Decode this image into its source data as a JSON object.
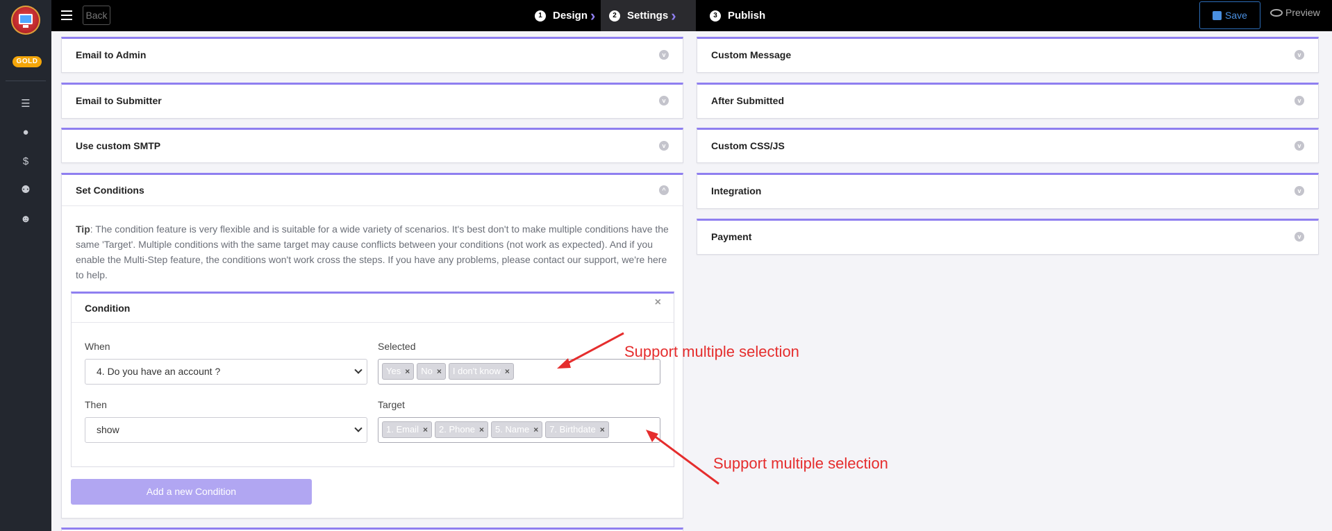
{
  "sidebar": {
    "badge": "GOLD",
    "items": [
      {
        "icon": "list-icon"
      },
      {
        "icon": "user-icon"
      },
      {
        "icon": "dollar-icon"
      },
      {
        "icon": "users-icon"
      },
      {
        "icon": "face-icon"
      }
    ]
  },
  "topbar": {
    "back_label": "Back",
    "steps": [
      {
        "num": "1",
        "label": "Design"
      },
      {
        "num": "2",
        "label": "Settings"
      },
      {
        "num": "3",
        "label": "Publish"
      }
    ],
    "save_label": "Save",
    "preview_label": "Preview"
  },
  "left_panels": {
    "email_admin": "Email to Admin",
    "email_submitter": "Email to Submitter",
    "custom_smtp": "Use custom SMTP",
    "set_conditions": "Set Conditions"
  },
  "right_panels": {
    "custom_message": "Custom Message",
    "after_submitted": "After Submitted",
    "custom_css_js": "Custom CSS/JS",
    "integration": "Integration",
    "payment": "Payment"
  },
  "conditions": {
    "tip_label": "Tip",
    "tip_text": ": The condition feature is very flexible and is suitable for a wide variety of scenarios. It's best don't to make multiple conditions have the same 'Target'. Multiple conditions with the same target may cause conflicts between your conditions (not work as expected). And if you enable the Multi-Step feature, the conditions won't work cross the steps. If you have any problems, please contact our support, we're here to help.",
    "condition_title": "Condition",
    "when_label": "When",
    "when_value": "4. Do you have an account ?",
    "selected_label": "Selected",
    "selected_tags": [
      "Yes",
      "No",
      "I don't know"
    ],
    "then_label": "Then",
    "then_value": "show",
    "target_label": "Target",
    "target_tags": [
      "1. Email",
      "2. Phone",
      "5. Name",
      "7. Birthdate"
    ],
    "add_button": "Add a new Condition"
  },
  "annotations": {
    "first": "Support multiple selection",
    "second": "Support multiple selection",
    "color": "#e52d2d"
  }
}
